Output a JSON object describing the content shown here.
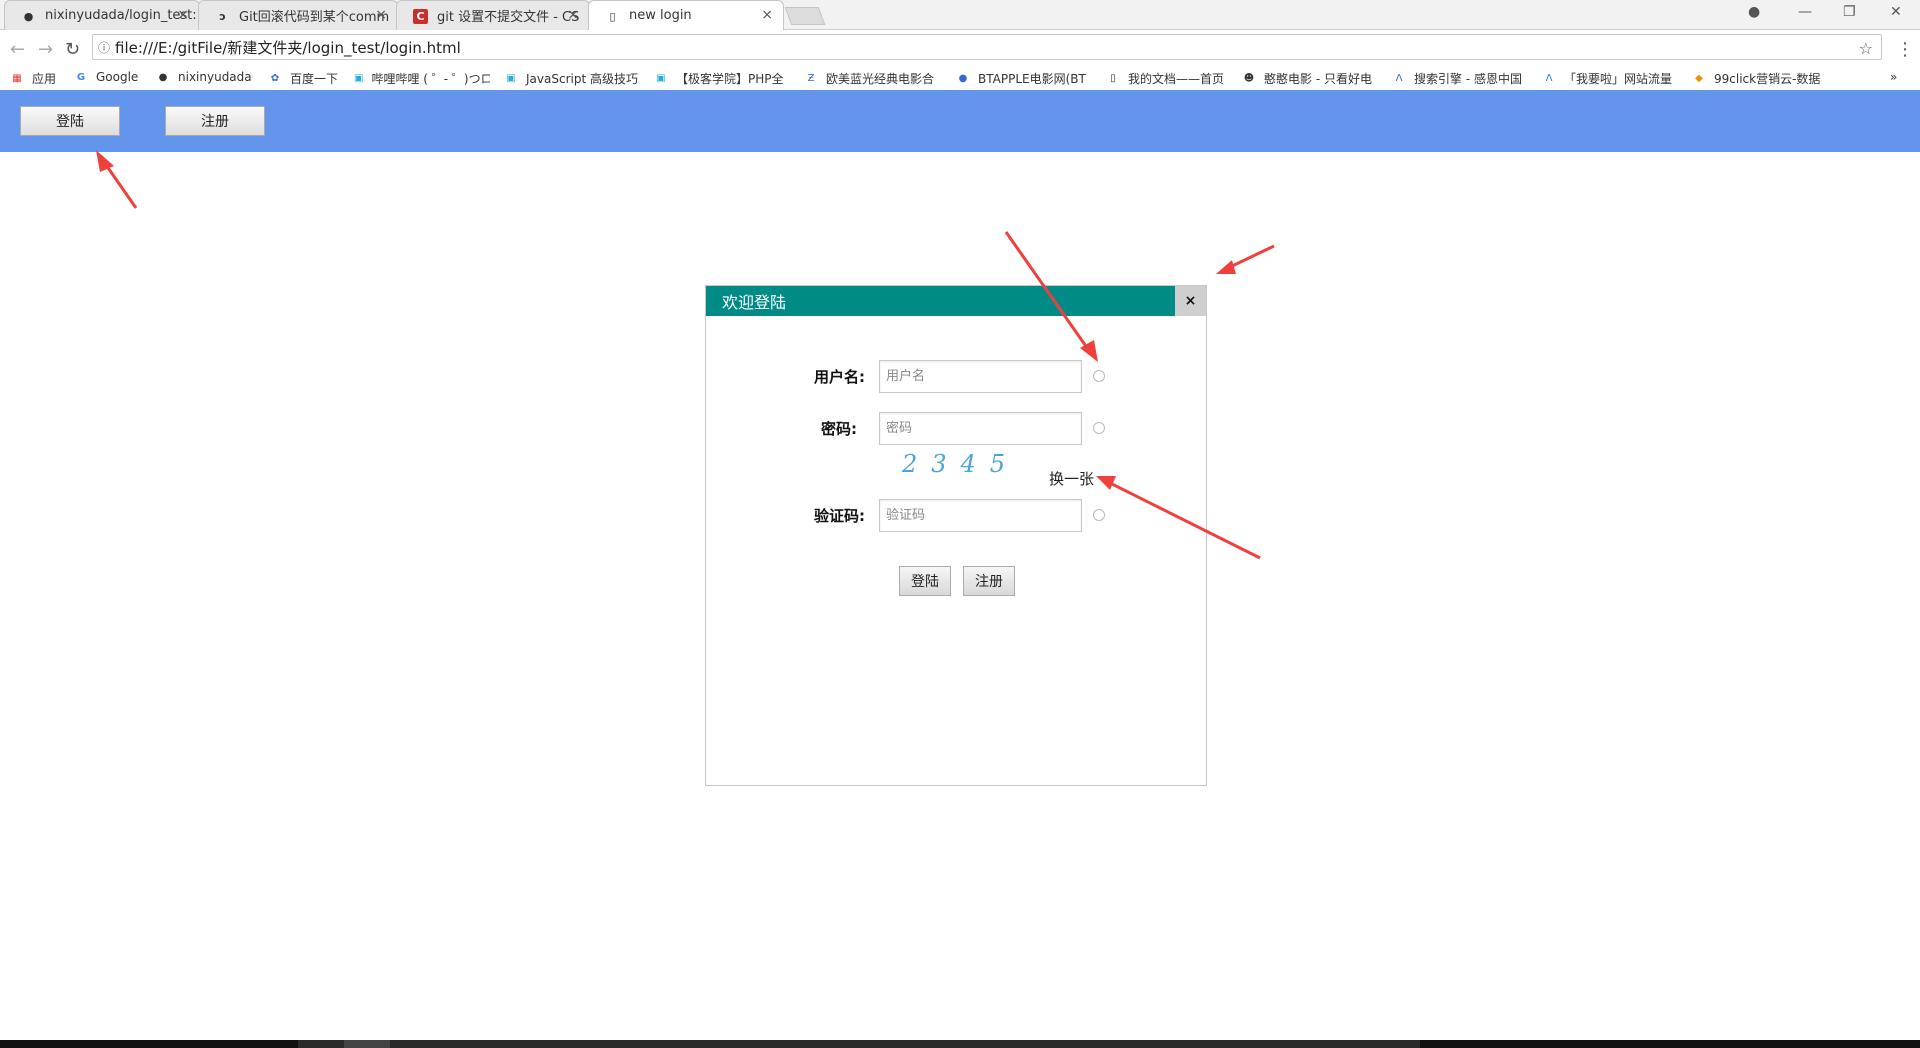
{
  "browser": {
    "tabs": [
      {
        "title": "nixinyudada/login_test:",
        "icon": "github-icon"
      },
      {
        "title": "Git回滚代码到某个comm",
        "icon": "git-icon"
      },
      {
        "title": "git 设置不提交文件 - CS",
        "icon": "csdn-icon"
      },
      {
        "title": "new login",
        "icon": "page-icon"
      }
    ],
    "tab_close": "×",
    "address": "file:///E:/gitFile/新建文件夹/login_test/login.html",
    "bookmarks": [
      {
        "label": "应用",
        "icon": "apps-icon"
      },
      {
        "label": "Google",
        "icon": "google-icon"
      },
      {
        "label": "nixinyudada",
        "icon": "github-icon"
      },
      {
        "label": "百度一下",
        "icon": "baidu-icon"
      },
      {
        "label": "哔哩哔哩 ( ゜- ゜)つロ",
        "icon": "bilibili-icon"
      },
      {
        "label": "JavaScript 高级技巧",
        "icon": "bilibili-icon"
      },
      {
        "label": "【极客学院】PHP全",
        "icon": "bilibili-icon"
      },
      {
        "label": "欧美蓝光经典电影合",
        "icon": "z-icon"
      },
      {
        "label": "BTAPPLE电影网(BT",
        "icon": "apple-icon"
      },
      {
        "label": "我的文档——首页",
        "icon": "doc-icon"
      },
      {
        "label": "憨憨电影 - 只看好电",
        "icon": "dog-icon"
      },
      {
        "label": "搜索引擎 - 感恩中国",
        "icon": "a-icon"
      },
      {
        "label": "「我要啦」网站流量",
        "icon": "a-icon"
      },
      {
        "label": "99click营销云-数据",
        "icon": "click-icon"
      }
    ]
  },
  "header": {
    "login_label": "登陆",
    "register_label": "注册"
  },
  "dialog": {
    "title": "欢迎登陆",
    "close_label": "×",
    "username_label": "用户名:",
    "username_placeholder": "用户名",
    "password_label": "密码:",
    "password_placeholder": "密码",
    "captcha_text": "2345",
    "refresh_label": "换一张",
    "code_label": "验证码:",
    "code_placeholder": "验证码",
    "login_label": "登陆",
    "register_label": "注册"
  },
  "colors": {
    "header_bg": "#6495ed",
    "dialog_title_bg": "#008b87",
    "annotation_arrow": "#f0403c"
  }
}
